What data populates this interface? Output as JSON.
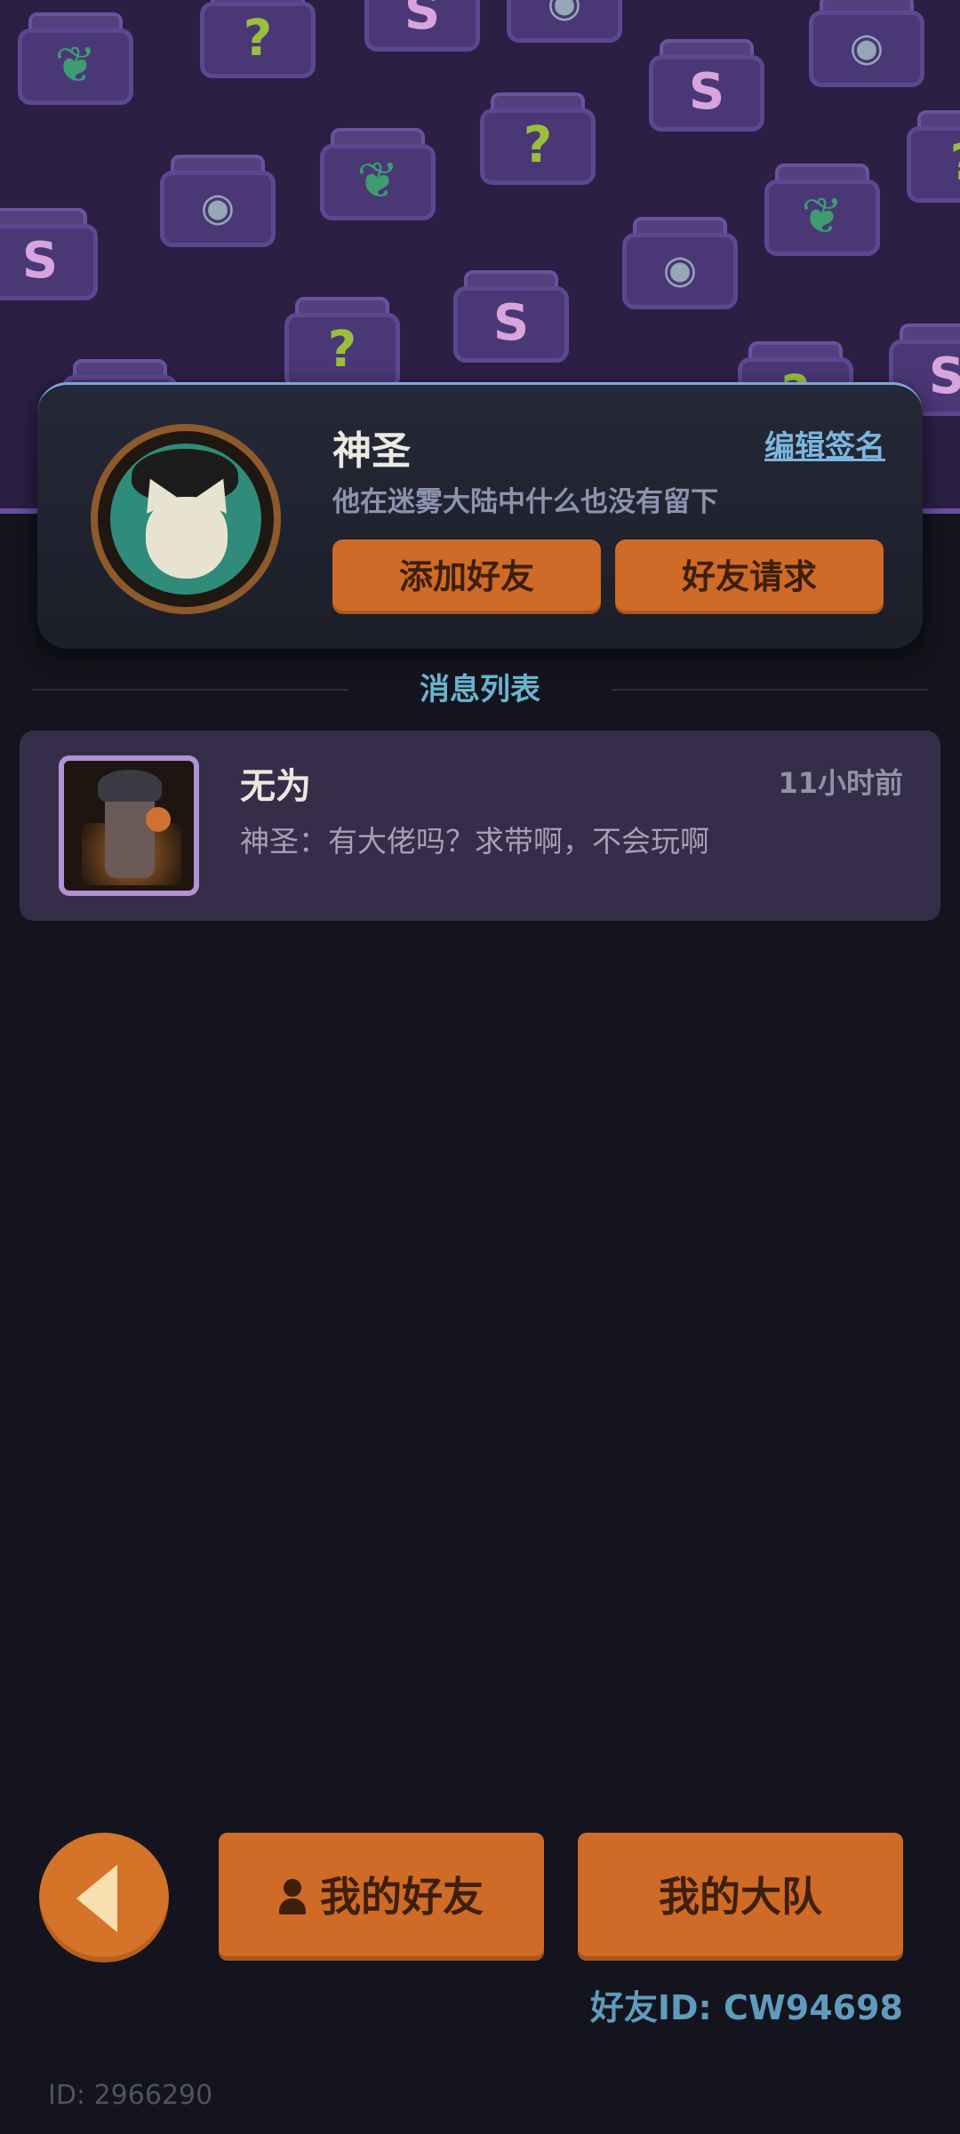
{
  "profile": {
    "name": "神圣",
    "edit_signature_label": "编辑签名",
    "signature": "他在迷雾大陆中什么也没有留下",
    "add_friend_label": "添加好友",
    "friend_request_label": "好友请求"
  },
  "messages": {
    "section_title": "消息列表",
    "items": [
      {
        "name": "无为",
        "time": "11小时前",
        "preview": "神圣：有大佬吗？求带啊，不会玩啊"
      }
    ]
  },
  "footer": {
    "my_friends_label": "我的好友",
    "my_squad_label": "我的大队",
    "friend_id": "好友ID: CW94698",
    "user_id": "ID: 2966290"
  },
  "icons": {
    "back": "back-arrow-icon",
    "person": "person-icon"
  },
  "colors": {
    "accent_orange": "#d06a27",
    "link_blue": "#7bb6de",
    "background": "#13141d",
    "header_purple": "#2b1f44"
  }
}
